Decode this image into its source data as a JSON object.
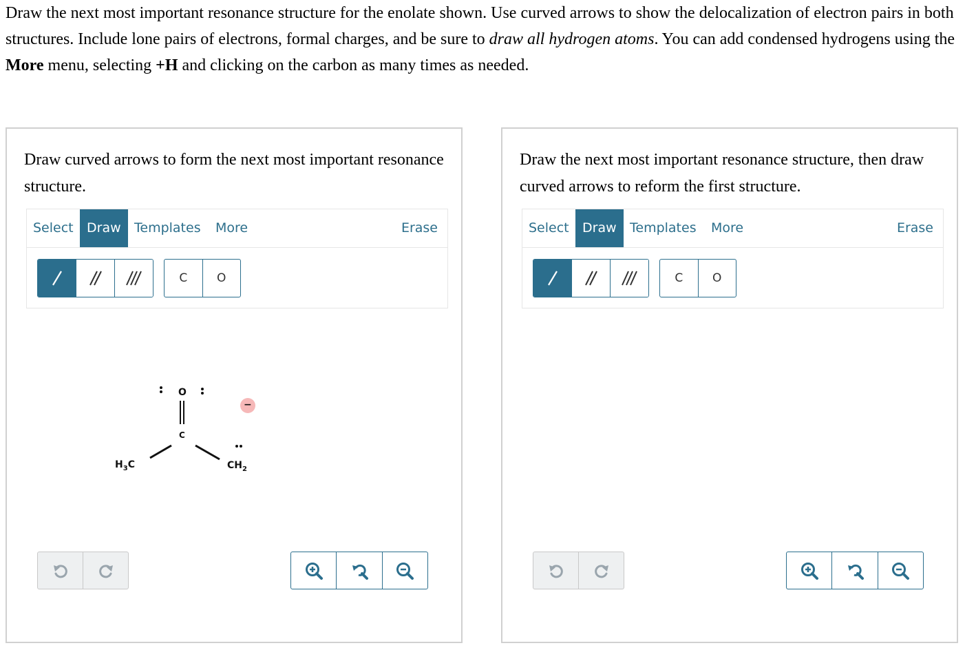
{
  "instructions": {
    "part1": "Draw the next most important resonance structure for the enolate shown. Use curved arrows to show the delocalization of electron pairs in both structures. Include lone pairs of electrons, formal charges, and be sure to ",
    "emphasis": "draw all hydrogen atoms",
    "part2": ". You can add condensed hydrogens using the ",
    "more_bold": "More",
    "part3": " menu, selecting ",
    "plus_h_bold": "+H",
    "part4": " and clicking on the carbon as many times as needed."
  },
  "panels": [
    {
      "prompt": "Draw curved arrows to form the next most important resonance structure.",
      "tabs": {
        "select": "Select",
        "draw": "Draw",
        "templates": "Templates",
        "more": "More",
        "erase": "Erase"
      },
      "atoms": {
        "carbon": "C",
        "oxygen": "O"
      },
      "molecule": {
        "o_atom": "O",
        "c_atom": "C",
        "methyl_label": "H",
        "methyl_sub": "3",
        "methyl_c": "C",
        "ch2_label": "CH",
        "ch2_sub": "2",
        "charge": "−"
      }
    },
    {
      "prompt": "Draw the next most important resonance structure, then draw curved arrows to reform the first structure.",
      "tabs": {
        "select": "Select",
        "draw": "Draw",
        "templates": "Templates",
        "more": "More",
        "erase": "Erase"
      },
      "atoms": {
        "carbon": "C",
        "oxygen": "O"
      }
    }
  ],
  "colors": {
    "accent": "#2b6e8d",
    "charge_badge": "#f6b8b8",
    "border": "#d0d0d0"
  },
  "icons": {
    "single_bond": "single-bond-icon",
    "double_bond": "double-bond-icon",
    "triple_bond": "triple-bond-icon",
    "undo": "undo-icon",
    "redo": "redo-icon",
    "zoom_in": "zoom-in-icon",
    "zoom_reset": "zoom-reset-icon",
    "zoom_out": "zoom-out-icon"
  }
}
